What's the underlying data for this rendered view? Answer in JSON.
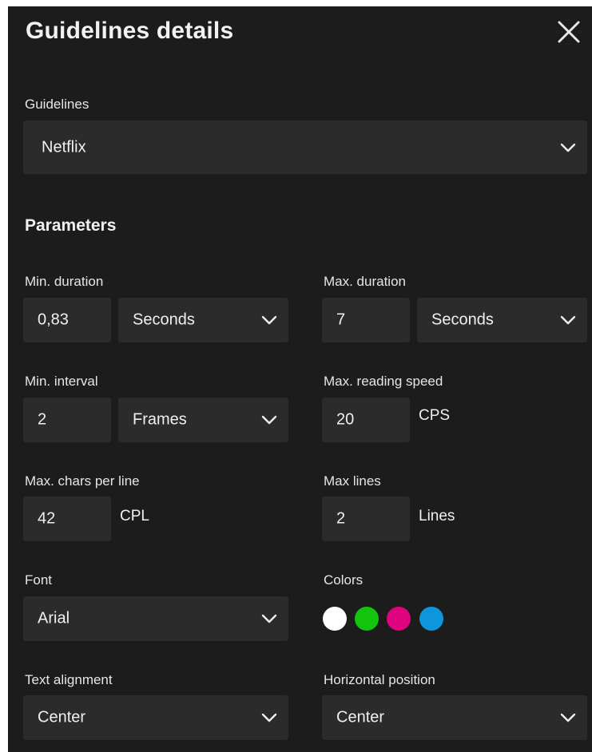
{
  "header": {
    "title": "Guidelines details"
  },
  "guidelines": {
    "label": "Guidelines",
    "value": "Netflix"
  },
  "parameters": {
    "title": "Parameters",
    "min_duration": {
      "label": "Min. duration",
      "value": "0,83",
      "unit": "Seconds"
    },
    "max_duration": {
      "label": "Max. duration",
      "value": "7",
      "unit": "Seconds"
    },
    "min_interval": {
      "label": "Min. interval",
      "value": "2",
      "unit": "Frames"
    },
    "max_reading_speed": {
      "label": "Max. reading speed",
      "value": "20",
      "unit": "CPS"
    },
    "max_chars_per_line": {
      "label": "Max. chars per line",
      "value": "42",
      "unit": "CPL"
    },
    "max_lines": {
      "label": "Max lines",
      "value": "2",
      "unit": "Lines"
    },
    "font": {
      "label": "Font",
      "value": "Arial"
    },
    "colors": {
      "label": "Colors",
      "swatches": [
        "#ffffff",
        "#12c40d",
        "#e0037f",
        "#0d96db"
      ]
    },
    "text_alignment": {
      "label": "Text alignment",
      "value": "Center"
    },
    "horizontal_position": {
      "label": "Horizontal position",
      "value": "Center"
    }
  },
  "icons": {
    "close": "close-icon",
    "dropdown": "chevron-down-icon"
  }
}
